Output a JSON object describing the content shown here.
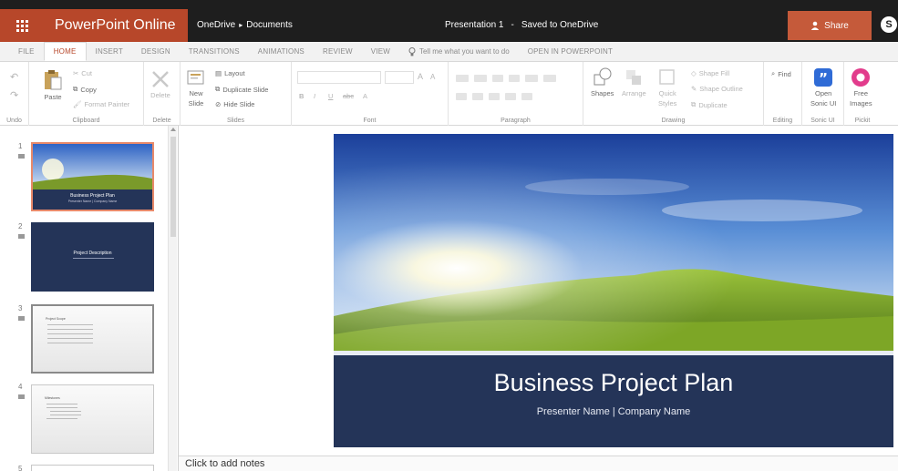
{
  "app": {
    "brand": "PowerPoint Online",
    "breadcrumb_root": "OneDrive",
    "breadcrumb_sep": "▸",
    "breadcrumb_folder": "Documents",
    "doc_title": "Presentation 1",
    "doc_status_sep": "-",
    "doc_status": "Saved to OneDrive",
    "share_label": "Share",
    "accent": "#b7472a"
  },
  "tabs": [
    "FILE",
    "HOME",
    "INSERT",
    "DESIGN",
    "TRANSITIONS",
    "ANIMATIONS",
    "REVIEW",
    "VIEW"
  ],
  "tell_me": "Tell me what you want to do",
  "open_in_ppt": "OPEN IN POWERPOINT",
  "ribbon": {
    "undo_group": "Undo",
    "paste": "Paste",
    "cut": "Cut",
    "copy": "Copy",
    "format_painter": "Format Painter",
    "clipboard_group": "Clipboard",
    "delete": "Delete",
    "delete_group": "Delete",
    "new_slide_line1": "New",
    "new_slide_line2": "Slide",
    "layout": "Layout",
    "duplicate_slide": "Duplicate Slide",
    "hide_slide": "Hide Slide",
    "slides_group": "Slides",
    "font_group": "Font",
    "paragraph_group": "Paragraph",
    "shapes": "Shapes",
    "arrange": "Arrange",
    "quick_styles_line1": "Quick",
    "quick_styles_line2": "Styles",
    "shape_fill": "Shape Fill",
    "shape_outline": "Shape Outline",
    "duplicate": "Duplicate",
    "drawing_group": "Drawing",
    "find": "Find",
    "editing_group": "Editing",
    "open_sonic_line1": "Open",
    "open_sonic_line2": "Sonic UI",
    "sonic_group": "Sonic UI",
    "free_images_line1": "Free",
    "free_images_line2": "Images",
    "pickit_group": "Pickit"
  },
  "slides": [
    {
      "number": "1",
      "title": "Business Project Plan",
      "subtitle": "Presenter Name | Company Name"
    },
    {
      "number": "2",
      "title": "Project Description",
      "subtitle": ""
    },
    {
      "number": "3",
      "title": "Project Scope",
      "subtitle": ""
    },
    {
      "number": "4",
      "title": "Milestones",
      "subtitle": ""
    },
    {
      "number": "5",
      "title": "",
      "subtitle": ""
    }
  ],
  "main_slide": {
    "title": "Business Project Plan",
    "subtitle": "Presenter Name | Company Name",
    "band_color": "#243458"
  },
  "notes_placeholder": "Click to add notes"
}
